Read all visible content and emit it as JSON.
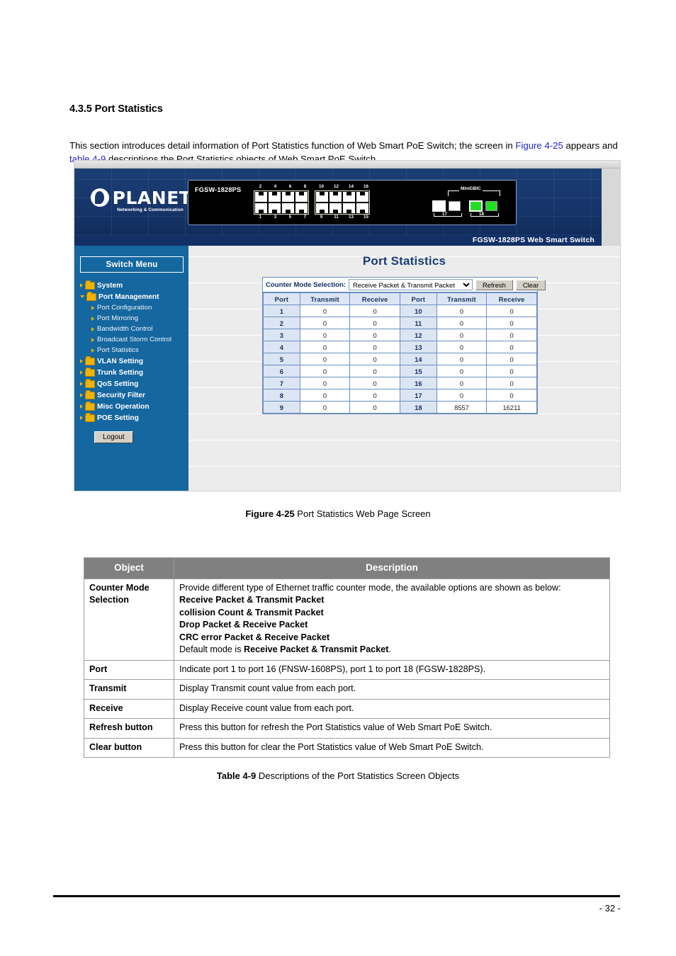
{
  "document": {
    "section_number": "4.3.5",
    "section_title": "4.3.5 Port Statistics",
    "intro_part1": "This section introduces detail information of Port Statistics function of Web Smart PoE Switch; the screen in ",
    "intro_link1": "Figure 4-25",
    "intro_part2": " appears and ",
    "intro_link2": "table 4-9",
    "intro_part3": " descriptions the Port Statistics objects of Web Smart PoE Switch.",
    "figure_caption_bold": "Figure 4-25",
    "figure_caption_text": " Port Statistics Web Page Screen",
    "table_caption_bold": "Table 4-9",
    "table_caption_text": " Descriptions of the Port Statistics Screen Objects",
    "page_number": "- 32 -"
  },
  "device_banner": {
    "brand": "PLANET",
    "brand_tagline": "Networking & Communication",
    "model": "FGSW-1828PS",
    "footer_label": "FGSW-1828PS Web Smart Switch",
    "sfp_bracket_label": "MiniGBIC",
    "rj45_top_labels_group1": [
      "2",
      "4",
      "6",
      "8"
    ],
    "rj45_bottom_labels_group1": [
      "1",
      "3",
      "5",
      "7"
    ],
    "rj45_top_labels_group2": [
      "10",
      "12",
      "14",
      "16"
    ],
    "rj45_bottom_labels_group2": [
      "9",
      "11",
      "13",
      "15"
    ],
    "combo_port_labels": [
      "17",
      "18"
    ]
  },
  "sidebar": {
    "menu_button": "Switch Menu",
    "logout_button": "Logout",
    "items": [
      {
        "label": "System",
        "expanded": false
      },
      {
        "label": "Port Management",
        "expanded": true
      },
      {
        "label": "VLAN Setting",
        "expanded": false
      },
      {
        "label": "Trunk Setting",
        "expanded": false
      },
      {
        "label": "QoS Setting",
        "expanded": false
      },
      {
        "label": "Security Filter",
        "expanded": false
      },
      {
        "label": "Misc Operation",
        "expanded": false
      },
      {
        "label": "POE Setting",
        "expanded": false
      }
    ],
    "port_management_children": [
      {
        "label": "Port Configuration"
      },
      {
        "label": "Port Mirroring"
      },
      {
        "label": "Bandwidth Control"
      },
      {
        "label": "Broadcast Storm Control"
      },
      {
        "label": "Port Statistics"
      }
    ]
  },
  "main": {
    "title": "Port Statistics",
    "counter_mode_label": "Counter Mode Selection:",
    "counter_mode_value": "Receive Packet & Transmit Packet",
    "counter_mode_options": [
      "Receive Packet & Transmit Packet",
      "collision Count & Transmit Packet",
      "Drop Packet & Receive Packet",
      "CRC error Packet & Receive Packet"
    ],
    "refresh_button": "Refresh",
    "clear_button": "Clear",
    "table_headers": [
      "Port",
      "Transmit",
      "Receive",
      "Port",
      "Transmit",
      "Receive"
    ],
    "rows": [
      [
        "1",
        "0",
        "0",
        "10",
        "0",
        "0"
      ],
      [
        "2",
        "0",
        "0",
        "11",
        "0",
        "0"
      ],
      [
        "3",
        "0",
        "0",
        "12",
        "0",
        "0"
      ],
      [
        "4",
        "0",
        "0",
        "13",
        "0",
        "0"
      ],
      [
        "5",
        "0",
        "0",
        "14",
        "0",
        "0"
      ],
      [
        "6",
        "0",
        "0",
        "15",
        "0",
        "0"
      ],
      [
        "7",
        "0",
        "0",
        "16",
        "0",
        "0"
      ],
      [
        "8",
        "0",
        "0",
        "17",
        "0",
        "0"
      ],
      [
        "9",
        "0",
        "0",
        "18",
        "8557",
        "16211"
      ]
    ]
  },
  "desc_table": {
    "headers": [
      "Object",
      "Description"
    ],
    "rows": [
      {
        "object": "Counter Mode Selection",
        "lines": [
          {
            "text": "Provide different type of Ethernet traffic counter mode, the available options are shown as below:",
            "bold": false
          },
          {
            "text": "Receive Packet & Transmit Packet",
            "bold": true
          },
          {
            "text": "collision Count & Transmit Packet",
            "bold": true
          },
          {
            "text": "Drop Packet & Receive Packet",
            "bold": true
          },
          {
            "text": "CRC error Packet & Receive Packet",
            "bold": true
          },
          {
            "text": "Default mode is ",
            "bold": false,
            "bold_tail": "Receive Packet & Transmit Packet",
            "tail": "."
          }
        ]
      },
      {
        "object": "Port",
        "lines": [
          {
            "text": "Indicate port 1 to port 16 (FNSW-1608PS),  port 1 to port 18 (FGSW-1828PS).",
            "bold": false
          }
        ]
      },
      {
        "object": "Transmit",
        "lines": [
          {
            "text": "Display Transmit count value from each port.",
            "bold": false
          }
        ]
      },
      {
        "object": "Receive",
        "lines": [
          {
            "text": "Display Receive count value from each port.",
            "bold": false
          }
        ]
      },
      {
        "object": "Refresh button",
        "lines": [
          {
            "text": "Press this button for refresh the Port Statistics value of Web Smart PoE Switch.",
            "bold": false
          }
        ]
      },
      {
        "object": "Clear button",
        "lines": [
          {
            "text": "Press this button for clear the Port Statistics value of Web Smart PoE Switch.",
            "bold": false
          }
        ]
      }
    ]
  },
  "colors": {
    "sidebar_blue": "#15679f",
    "banner_blue": "#16356a",
    "title_blue": "#1b3e75",
    "table_header_blue": "#dbe5f3",
    "table_border_blue": "#6c8fc2",
    "desc_header_gray": "#808080",
    "link_blue": "#2222cc",
    "led_green": "#22dd22",
    "folder_yellow": "#f0b400"
  }
}
